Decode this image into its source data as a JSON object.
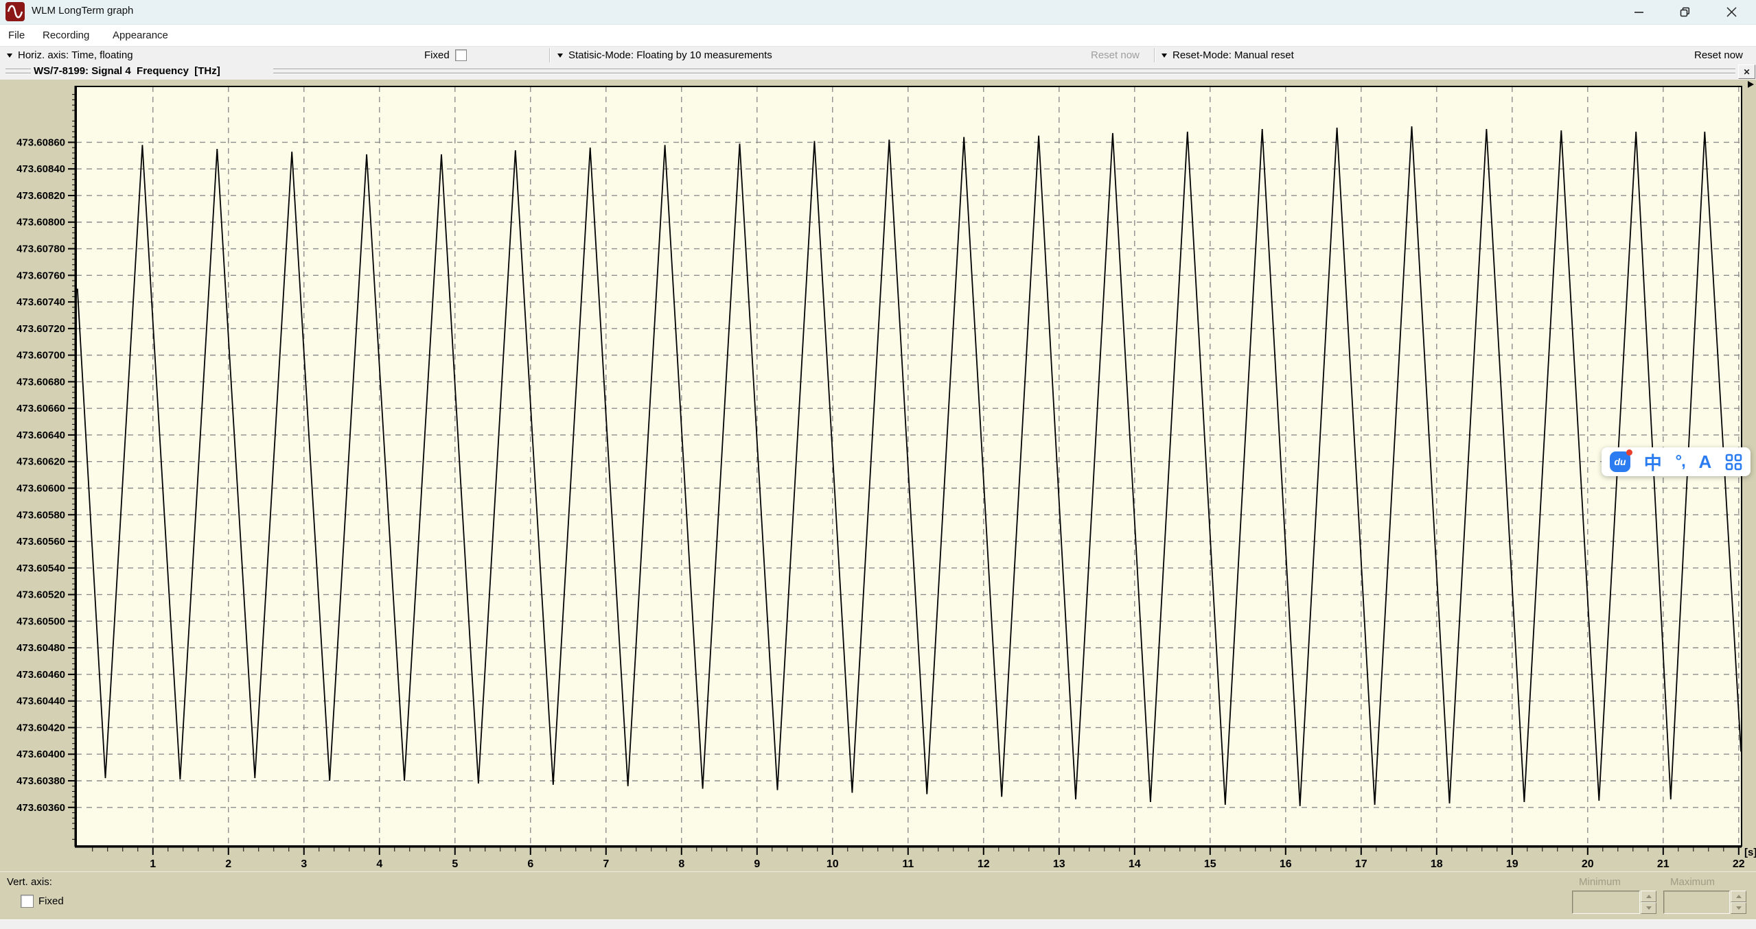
{
  "window": {
    "title": "WLM LongTerm graph"
  },
  "menu": {
    "items": [
      "File",
      "Recording",
      "Appearance"
    ]
  },
  "toolbar": {
    "horiz_axis_dropdown": "Horiz. axis: Time, floating",
    "fixed_checkbox_label": "Fixed",
    "fixed_checked": false,
    "statistic_mode_dropdown": "Statisic-Mode: Floating by 10 measurements",
    "reset_now_left": "Reset now",
    "reset_now_left_enabled": false,
    "reset_mode_dropdown": "Reset-Mode: Manual reset",
    "reset_now_right": "Reset now"
  },
  "graph_header": {
    "title": "WS/7-8199: Signal 4  Frequency  [THz]",
    "close_button": "✕"
  },
  "chart_data": {
    "type": "line",
    "title": "WS/7-8199: Signal 4  Frequency  [THz]",
    "x_unit": "[s]",
    "xlim": [
      -0.016,
      22.038
    ],
    "ylim": [
      473.60331,
      473.60902
    ],
    "x_ticks": [
      1,
      2,
      3,
      4,
      5,
      6,
      7,
      8,
      9,
      10,
      11,
      12,
      13,
      14,
      15,
      16,
      17,
      18,
      19,
      20,
      21,
      22
    ],
    "x_minor_step": 0.2,
    "y_ticks": [
      473.6036,
      473.6038,
      473.604,
      473.6042,
      473.6044,
      473.6046,
      473.6048,
      473.605,
      473.6052,
      473.6054,
      473.6056,
      473.6058,
      473.606,
      473.6062,
      473.6064,
      473.6066,
      473.6068,
      473.607,
      473.6072,
      473.6074,
      473.6076,
      473.6078,
      473.608,
      473.6082,
      473.6084,
      473.6086
    ],
    "y_minor_step": 4e-05,
    "grid": true,
    "series": [
      {
        "name": "Signal 4 Frequency (THz)",
        "color": "#000000",
        "points": [
          [
            0.0,
            473.6075
          ],
          [
            0.37,
            473.60382
          ],
          [
            0.86,
            473.60858
          ],
          [
            1.36,
            473.60381
          ],
          [
            1.85,
            473.60855
          ],
          [
            2.35,
            473.60382
          ],
          [
            2.84,
            473.60853
          ],
          [
            3.34,
            473.6038
          ],
          [
            3.83,
            473.60851
          ],
          [
            4.33,
            473.6038
          ],
          [
            4.82,
            473.60851
          ],
          [
            5.31,
            473.60378
          ],
          [
            5.8,
            473.60854
          ],
          [
            6.3,
            473.60377
          ],
          [
            6.79,
            473.60856
          ],
          [
            7.29,
            473.60376
          ],
          [
            7.78,
            473.60858
          ],
          [
            8.28,
            473.60374
          ],
          [
            8.77,
            473.60859
          ],
          [
            9.27,
            473.60373
          ],
          [
            9.76,
            473.60861
          ],
          [
            10.26,
            473.60371
          ],
          [
            10.75,
            473.60862
          ],
          [
            11.25,
            473.6037
          ],
          [
            11.74,
            473.60864
          ],
          [
            12.24,
            473.60368
          ],
          [
            12.73,
            473.60865
          ],
          [
            13.22,
            473.60366
          ],
          [
            13.71,
            473.60867
          ],
          [
            14.21,
            473.60364
          ],
          [
            14.7,
            473.60868
          ],
          [
            15.2,
            473.60362
          ],
          [
            15.69,
            473.6087
          ],
          [
            16.19,
            473.60361
          ],
          [
            16.68,
            473.60871
          ],
          [
            17.18,
            473.60362
          ],
          [
            17.67,
            473.60872
          ],
          [
            18.17,
            473.60363
          ],
          [
            18.66,
            473.6087
          ],
          [
            19.16,
            473.60364
          ],
          [
            19.65,
            473.60869
          ],
          [
            20.15,
            473.60365
          ],
          [
            20.64,
            473.60868
          ],
          [
            21.1,
            473.60366
          ],
          [
            21.55,
            473.60868
          ],
          [
            22.03,
            473.60402
          ]
        ]
      }
    ]
  },
  "ime_toolbar": {
    "icons": [
      {
        "name": "baidu-ime-logo",
        "label": "du",
        "badge": true
      },
      {
        "name": "chinese-english-toggle",
        "label": "中"
      },
      {
        "name": "punctuation-toggle",
        "label": "°,"
      },
      {
        "name": "font-style",
        "label": "A"
      },
      {
        "name": "apps-grid",
        "label": ""
      }
    ]
  },
  "vert_axis_panel": {
    "label": "Vert. axis:",
    "fixed_checkbox_label": "Fixed",
    "fixed_checked": false,
    "minimum_label": "Minimum",
    "maximum_label": "Maximum",
    "minimum_value": "",
    "maximum_value": ""
  },
  "colors": {
    "titlebar": "#e8f1f4",
    "app_icon_red": "#8b1717",
    "panel_beige": "#d4d0b4",
    "plot_ivory": "#fcfce8",
    "grid": "#8c8c8c",
    "curve": "#000000",
    "accent_blue": "#2b7cf0",
    "badge_red": "#e8402f"
  }
}
